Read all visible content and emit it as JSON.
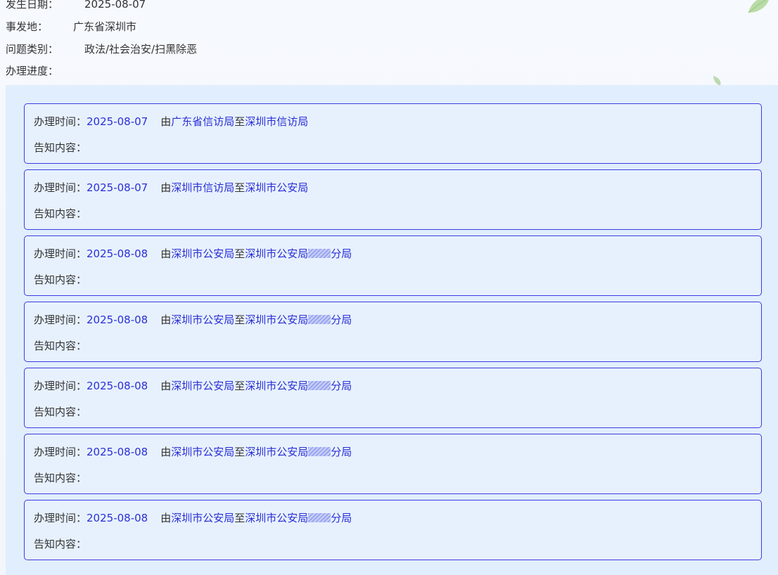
{
  "meta": {
    "date_label": "发生日期：",
    "date_value": "2025-08-07",
    "place_label": "事发地：",
    "place_value": "广东省深圳市",
    "category_label": "问题类别：",
    "category_value": "政法/社会治安/扫黑除恶",
    "progress_label": "办理进度："
  },
  "records_common": {
    "time_label": "办理时间：",
    "from_prefix": "由",
    "to_word": "至",
    "content_label": "告知内容："
  },
  "records": [
    {
      "time": "2025-08-07",
      "from": "广东省信访局",
      "to": "深圳市信访局",
      "to_suffix": ""
    },
    {
      "time": "2025-08-07",
      "from": "深圳市信访局",
      "to": "深圳市公安局",
      "to_suffix": ""
    },
    {
      "time": "2025-08-08",
      "from": "深圳市公安局",
      "to": "深圳市公安局",
      "to_suffix": "分局"
    },
    {
      "time": "2025-08-08",
      "from": "深圳市公安局",
      "to": "深圳市公安局",
      "to_suffix": "分局"
    },
    {
      "time": "2025-08-08",
      "from": "深圳市公安局",
      "to": "深圳市公安局",
      "to_suffix": "分局"
    },
    {
      "time": "2025-08-08",
      "from": "深圳市公安局",
      "to": "深圳市公安局",
      "to_suffix": "分局"
    },
    {
      "time": "2025-08-08",
      "from": "深圳市公安局",
      "to": "深圳市公安局",
      "to_suffix": "分局"
    }
  ],
  "colors": {
    "link_blue": "#2a2fd6",
    "card_border": "#3a3de0",
    "panel_bg": "#e1eefd"
  },
  "icons": {
    "leaf": "leaf-icon",
    "redaction": "redaction-mark"
  }
}
